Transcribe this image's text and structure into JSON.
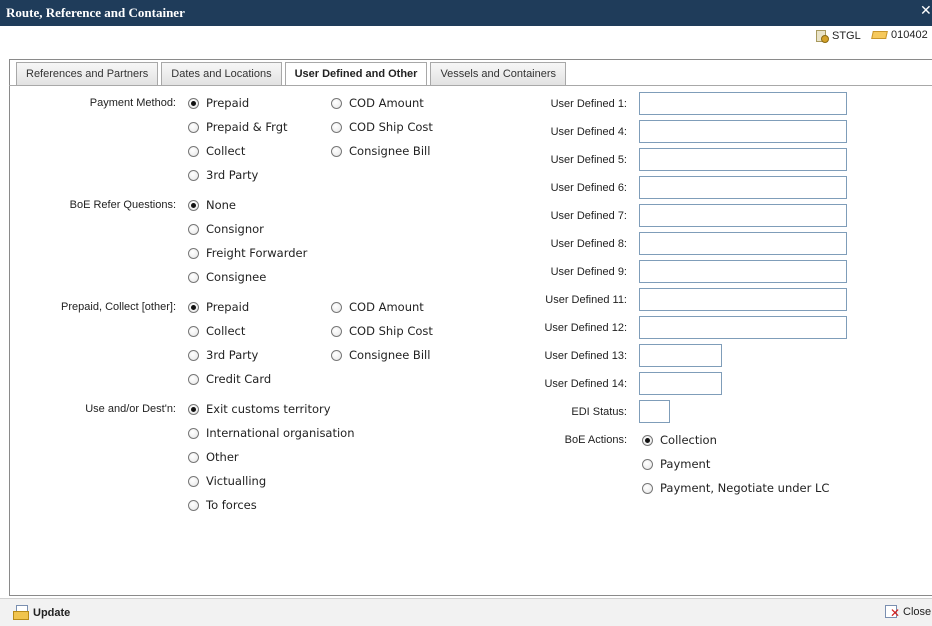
{
  "window": {
    "title": "Route, Reference and Container",
    "close_glyph": "✕"
  },
  "infobar": {
    "stgl_label": "STGL",
    "reference_label": "010402"
  },
  "tabs": [
    {
      "label": "References and Partners",
      "active": false
    },
    {
      "label": "Dates and Locations",
      "active": false
    },
    {
      "label": "User Defined and Other",
      "active": true
    },
    {
      "label": "Vessels and Containers",
      "active": false
    }
  ],
  "payment_method": {
    "label": "Payment Method:",
    "options": [
      "Prepaid",
      "Prepaid & Frgt",
      "Collect",
      "3rd Party",
      "COD Amount",
      "COD Ship Cost",
      "Consignee Bill"
    ],
    "selected": "Prepaid"
  },
  "boe_refer": {
    "label": "BoE Refer Questions:",
    "options": [
      "None",
      "Consignor",
      "Freight Forwarder",
      "Consignee"
    ],
    "selected": "None"
  },
  "prepaid_collect_other": {
    "label": "Prepaid, Collect [other]:",
    "options": [
      "Prepaid",
      "Collect",
      "3rd Party",
      "Credit Card",
      "COD Amount",
      "COD Ship Cost",
      "Consignee Bill"
    ],
    "selected": "Prepaid"
  },
  "use_dest": {
    "label": "Use and/or Dest'n:",
    "options": [
      "Exit customs territory",
      "International organisation",
      "Other",
      "Victualling",
      "To forces"
    ],
    "selected": "Exit customs territory"
  },
  "user_defined": [
    {
      "label": "User Defined 1:",
      "value": ""
    },
    {
      "label": "User Defined 4:",
      "value": ""
    },
    {
      "label": "User Defined 5:",
      "value": ""
    },
    {
      "label": "User Defined 6:",
      "value": ""
    },
    {
      "label": "User Defined 7:",
      "value": ""
    },
    {
      "label": "User Defined 8:",
      "value": ""
    },
    {
      "label": "User Defined 9:",
      "value": ""
    },
    {
      "label": "User Defined 11:",
      "value": ""
    },
    {
      "label": "User Defined 12:",
      "value": ""
    },
    {
      "label": "User Defined 13:",
      "value": ""
    },
    {
      "label": "User Defined 14:",
      "value": ""
    }
  ],
  "edi_status": {
    "label": "EDI Status:",
    "value": ""
  },
  "boe_actions": {
    "label": "BoE Actions:",
    "options": [
      "Collection",
      "Payment",
      "Payment, Negotiate under LC"
    ],
    "selected": "Collection"
  },
  "footer": {
    "update_label": "Update",
    "close_label": "Close"
  }
}
